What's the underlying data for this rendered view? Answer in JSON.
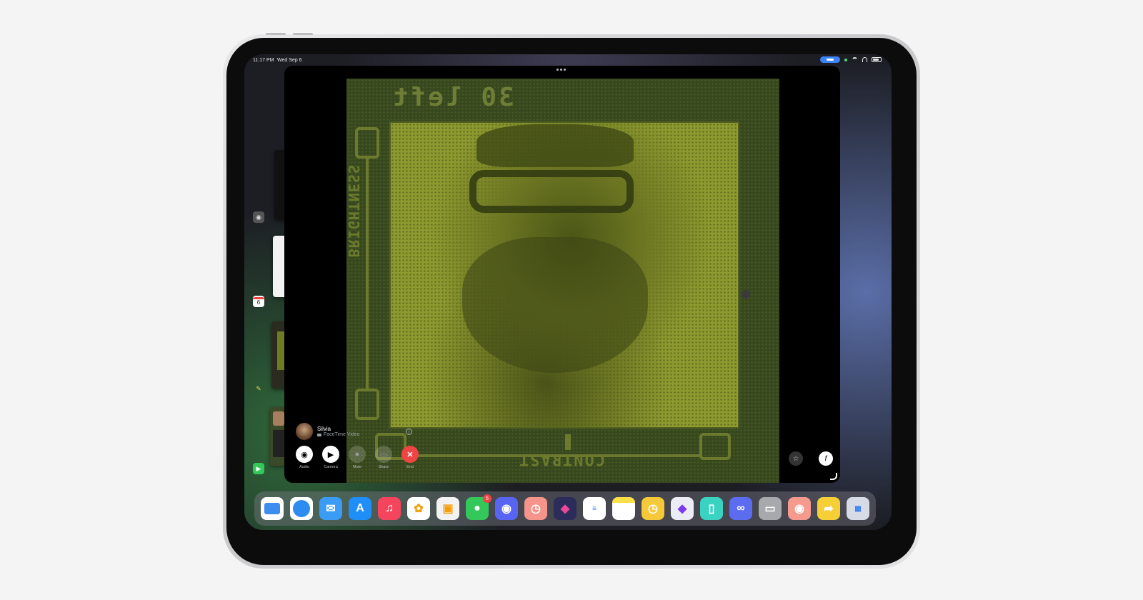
{
  "status_bar": {
    "time": "11:17 PM",
    "date": "Wed Sep 6"
  },
  "stage_manager": {
    "calendar_day": "6",
    "icons": [
      "camera-icon",
      "calendar-icon",
      "pencil-icon",
      "facetime-icon"
    ]
  },
  "game_screen": {
    "shots_left": "30 left",
    "vertical_label": "BRIGHTNESS",
    "horizontal_label": "CONTRAST"
  },
  "facetime": {
    "caller_name": "Silvia",
    "call_type": "FaceTime Video",
    "buttons": [
      {
        "label": "Audio",
        "icon": "airpods-icon"
      },
      {
        "label": "Camera",
        "icon": "video-camera-icon"
      },
      {
        "label": "Mute",
        "icon": "microphone-icon"
      },
      {
        "label": "Share",
        "icon": "share-screen-icon"
      },
      {
        "label": "End",
        "icon": "close-icon"
      }
    ]
  },
  "dock": {
    "apps": [
      {
        "name": "files-icon",
        "color": "#3b8ef0"
      },
      {
        "name": "safari-icon",
        "color": "#2d8cf0"
      },
      {
        "name": "mail-icon",
        "color": "#3b9cf5"
      },
      {
        "name": "app-store-icon",
        "color": "#1f8ff7"
      },
      {
        "name": "music-icon",
        "color": "#f5455c"
      },
      {
        "name": "photos-icon",
        "color": "#ffffff"
      },
      {
        "name": "translate-icon",
        "color": "#f2f2f2"
      },
      {
        "name": "messages-icon",
        "color": "#34c759",
        "badge": "5"
      },
      {
        "name": "discord-icon",
        "color": "#5865f2"
      },
      {
        "name": "timer-icon",
        "color": "#f5948a"
      },
      {
        "name": "shortcuts-icon",
        "color": "#3a3a72"
      },
      {
        "name": "reminders-icon",
        "color": "#ffffff"
      },
      {
        "name": "notes-icon",
        "color": "#fef3b0"
      },
      {
        "name": "clock-icon",
        "color": "#f6c93b"
      },
      {
        "name": "obsidian-icon",
        "color": "#ececf4"
      },
      {
        "name": "sidecar-icon",
        "color": "#3ad3c2"
      },
      {
        "name": "link-icon",
        "color": "#5b6cf0"
      },
      {
        "name": "display-icon",
        "color": "#a7a9ad"
      },
      {
        "name": "airplay-icon",
        "color": "#f59a8c"
      },
      {
        "name": "forward-icon",
        "color": "#f6cf37"
      },
      {
        "name": "app-library-icon",
        "color": "#d7dbe6"
      }
    ]
  }
}
